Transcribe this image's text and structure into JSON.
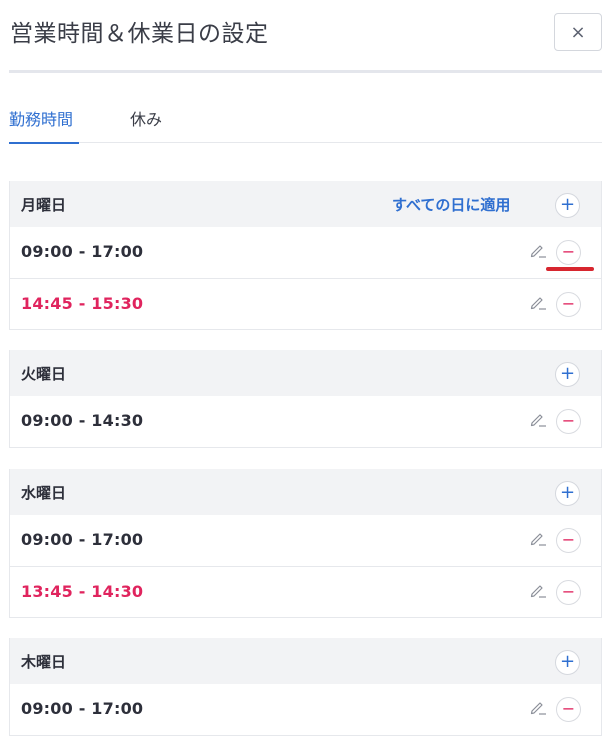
{
  "header": {
    "title": "営業時間＆休業日の設定",
    "close_label": "×"
  },
  "tabs": [
    {
      "label": "勤務時間",
      "active": true
    },
    {
      "label": "休み",
      "active": false
    }
  ],
  "apply_all_label": "すべての日に適用",
  "add_symbol": "+",
  "remove_symbol": "−",
  "colors": {
    "accent": "#2f6fd0",
    "alert_time": "#e0245e",
    "annotation": "#d7262f"
  },
  "days": [
    {
      "name": "月曜日",
      "slots": [
        {
          "time": "09:00 - 17:00",
          "highlight": false
        },
        {
          "time": "14:45 - 15:30",
          "highlight": true
        }
      ]
    },
    {
      "name": "火曜日",
      "slots": [
        {
          "time": "09:00 - 14:30",
          "highlight": false
        }
      ]
    },
    {
      "name": "水曜日",
      "slots": [
        {
          "time": "09:00 - 17:00",
          "highlight": false
        },
        {
          "time": "13:45 - 14:30",
          "highlight": true
        }
      ]
    },
    {
      "name": "木曜日",
      "slots": [
        {
          "time": "09:00 - 17:00",
          "highlight": false
        }
      ]
    }
  ]
}
